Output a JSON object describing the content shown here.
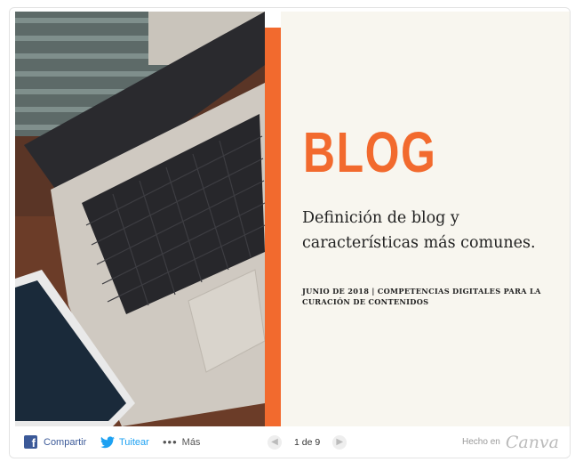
{
  "slide": {
    "title": "BLOG",
    "subtitle": "Definición de blog y características más comunes.",
    "meta": "JUNIO DE 2018 | COMPETENCIAS DIGITALES PARA LA CURACIÓN DE CONTENIDOS",
    "accent_color": "#f26a2e",
    "photo_description_icon": "laptop-photo"
  },
  "toolbar": {
    "share_label": "Compartir",
    "tweet_label": "Tuitear",
    "more_label": "Más",
    "page_label": "1 de 9",
    "made_in_label": "Hecho en",
    "brand": "Canva"
  },
  "icons": {
    "share": "facebook-icon",
    "tweet": "twitter-icon",
    "more": "more-dots-icon",
    "prev": "chevron-left-icon",
    "next": "chevron-right-icon"
  }
}
